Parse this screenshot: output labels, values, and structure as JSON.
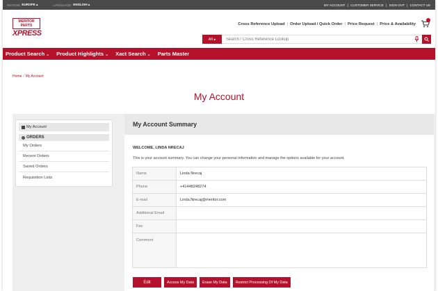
{
  "topbar": {
    "region_label": "REGION:",
    "region_value": "EUROPE",
    "language_label": "LANGUAGE:",
    "language_value": "ENGLISH",
    "links": [
      "MY ACCOUNT",
      "CUSTOMER SERVICE",
      "SIGN OUT",
      "CONTACT US"
    ],
    "separator": "|"
  },
  "logo": {
    "top": "MERITOR PARTS",
    "main": "XPRESS"
  },
  "quicklinks": [
    "Cross Reference Upload",
    "Order Upload / Quick Order",
    "Price Request",
    "Price & Availability"
  ],
  "search": {
    "scope": "All",
    "placeholder": "Search / Cross Reference Lookup"
  },
  "nav": [
    "Product Search",
    "Product Highlights",
    "Xact Search",
    "Parts Master"
  ],
  "breadcrumb": [
    "Home",
    "My Account"
  ],
  "page_title": "My Account",
  "sidebar": {
    "header": "My Account",
    "section": "ORDERS",
    "items": [
      "My Orders",
      "Recent Orders",
      "Saved Orders",
      "Requisition Lists"
    ]
  },
  "summary": {
    "title": "My Account Summary",
    "welcome": "WELCOME, LINDA NRECAJ",
    "description": "This is your account summary. You can change your personal information and manage the options available for your account.",
    "rows": [
      {
        "label": "Name",
        "value": "Linda Nrecaj"
      },
      {
        "label": "Phone",
        "value": "+41448248274"
      },
      {
        "label": "E-mail",
        "value": "Linda.Nrecaj@meritor.com"
      },
      {
        "label": "Additional Email",
        "value": ""
      },
      {
        "label": "Fax",
        "value": ""
      },
      {
        "label": "Comment",
        "value": ""
      }
    ],
    "buttons": [
      "Edit",
      "Access My Data",
      "Erase My Data",
      "Restrict Processing Of My Data"
    ]
  },
  "colors": {
    "brand": "#b5112b",
    "topbar": "#4a4a4a"
  }
}
